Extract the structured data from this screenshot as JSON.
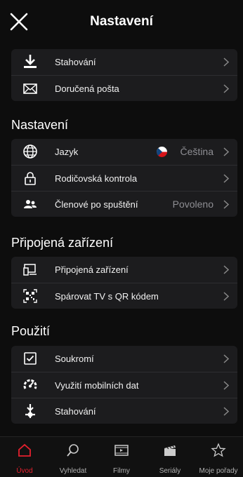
{
  "header": {
    "title": "Nastavení"
  },
  "top_group": [
    {
      "label": "Stahování",
      "icon": "download-icon"
    },
    {
      "label": "Doručená pošta",
      "icon": "mail-icon"
    }
  ],
  "settings": {
    "title": "Nastavení",
    "items": [
      {
        "label": "Jazyk",
        "value": "Čeština",
        "icon": "globe-icon"
      },
      {
        "label": "Rodičovská kontrola",
        "value": "",
        "icon": "lock-icon"
      },
      {
        "label": "Členové po spuštění",
        "value": "Povoleno",
        "icon": "users-icon"
      }
    ]
  },
  "devices": {
    "title": "Připojená zařízení",
    "items": [
      {
        "label": "Připojená zařízení",
        "icon": "devices-icon"
      },
      {
        "label": "Spárovat TV s QR kódem",
        "icon": "qr-code-icon"
      }
    ]
  },
  "usage": {
    "title": "Použití",
    "items": [
      {
        "label": "Soukromí",
        "icon": "checkbox-icon"
      },
      {
        "label": "Využití mobilních dat",
        "icon": "gauge-icon"
      },
      {
        "label": "Stahování",
        "icon": "download-settings-icon"
      }
    ]
  },
  "tabbar": {
    "tabs": [
      {
        "label": "Úvod",
        "icon": "home-icon",
        "active": true
      },
      {
        "label": "Vyhledat",
        "icon": "search-icon"
      },
      {
        "label": "Filmy",
        "icon": "film-icon"
      },
      {
        "label": "Seriály",
        "icon": "clapperboard-icon"
      },
      {
        "label": "Moje pořady",
        "icon": "star-icon"
      }
    ]
  },
  "colors": {
    "accent": "#e5202e",
    "background": "#0d0d0d",
    "card": "#1c1c1e",
    "muted": "#8e8e93"
  }
}
